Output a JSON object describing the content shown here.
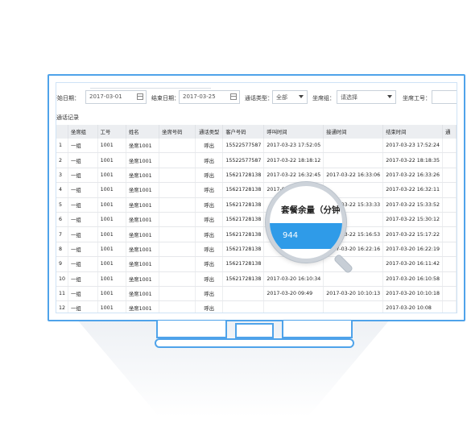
{
  "filters": {
    "start_label": "开始日期：",
    "start_value": "2017-03-01",
    "end_label": "结束日期：",
    "end_value": "2017-03-25",
    "calltype_label": "通话类型：",
    "calltype_value": "全部",
    "group_label": "坐席组：",
    "group_value": "请选择",
    "agent_label": "坐席工号："
  },
  "section_title": "通话记录",
  "table": {
    "headers": [
      "",
      "坐席组",
      "工号",
      "姓名",
      "坐席号码",
      "通话类型",
      "客户号码",
      "呼叫时间",
      "接通时间",
      "结束时间",
      "通"
    ],
    "rows": [
      [
        "1",
        "一组",
        "1001",
        "坐席1001",
        "",
        "呼出",
        "15522577587",
        "2017-03-23 17:52:05",
        "",
        "2017-03-23 17:52:24"
      ],
      [
        "2",
        "一组",
        "1001",
        "坐席1001",
        "",
        "呼出",
        "15522577587",
        "2017-03-22 18:18:12",
        "",
        "2017-03-22 18:18:35"
      ],
      [
        "3",
        "一组",
        "1001",
        "坐席1001",
        "",
        "呼出",
        "15621728138",
        "2017-03-22 16:32:45",
        "2017-03-22 16:33:06",
        "2017-03-22 16:33:26"
      ],
      [
        "4",
        "一组",
        "1001",
        "坐席1001",
        "",
        "呼出",
        "15621728138",
        "2017-03-22 16:31:43",
        "",
        "2017-03-22 16:32:11"
      ],
      [
        "5",
        "一组",
        "1001",
        "坐席1001",
        "",
        "呼出",
        "15621728138",
        "",
        "2017-03-22 15:33:33",
        "2017-03-22 15:33:52"
      ],
      [
        "6",
        "一组",
        "1001",
        "坐席1001",
        "",
        "呼出",
        "15621728138",
        "",
        "",
        "2017-03-22 15:30:12"
      ],
      [
        "7",
        "一组",
        "1001",
        "坐席1001",
        "",
        "呼出",
        "15621728138",
        "",
        "2017-03-22 15:16:53",
        "2017-03-22 15:17:22"
      ],
      [
        "8",
        "一组",
        "1001",
        "坐席1001",
        "",
        "呼出",
        "15621728138",
        "",
        "2017-03-20 16:22:16",
        "2017-03-20 16:22:19"
      ],
      [
        "9",
        "一组",
        "1001",
        "坐席1001",
        "",
        "呼出",
        "15621728138",
        "",
        "",
        "2017-03-20 16:11:42"
      ],
      [
        "10",
        "一组",
        "1001",
        "坐席1001",
        "",
        "呼出",
        "15621728138",
        "2017-03-20 16:10:34",
        "",
        "2017-03-20 16:10:58"
      ],
      [
        "11",
        "一组",
        "1001",
        "坐席1001",
        "",
        "呼出",
        "",
        "2017-03-20 09:49",
        "2017-03-20 10:10:13",
        "2017-03-20 10:10:18"
      ],
      [
        "12",
        "一组",
        "1001",
        "坐席1001",
        "",
        "呼出",
        "",
        "",
        "",
        "2017-03-20 10:08"
      ]
    ]
  },
  "magnifier": {
    "title": "套餐余量（分钟",
    "value": "944"
  },
  "colors": {
    "accent": "#2f9be8",
    "frame": "#4fa3ea"
  }
}
